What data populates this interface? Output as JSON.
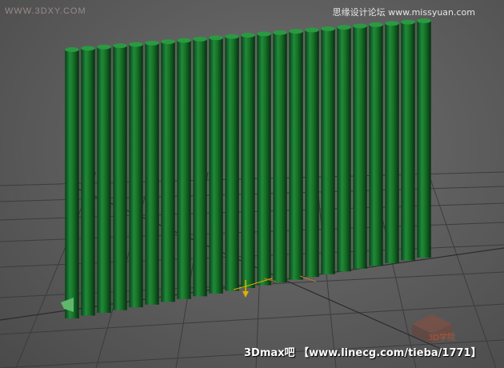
{
  "watermarks": {
    "top_left": "WWW.3DXY.COM",
    "top_right": "思缘设计论坛 www.missyuan.com",
    "bottom_left": "3Dmax吧",
    "bottom_right": "【www.linecg.com/tieba/1771】",
    "logo_text": "3D学院"
  },
  "viewport": {
    "object": "vertical-slat-fence",
    "slat_count": 23,
    "slat_color": "#1a7a30",
    "grid_color": "#3c3c3c",
    "background_color": "#626262",
    "pivot_color": "#e0b000"
  }
}
